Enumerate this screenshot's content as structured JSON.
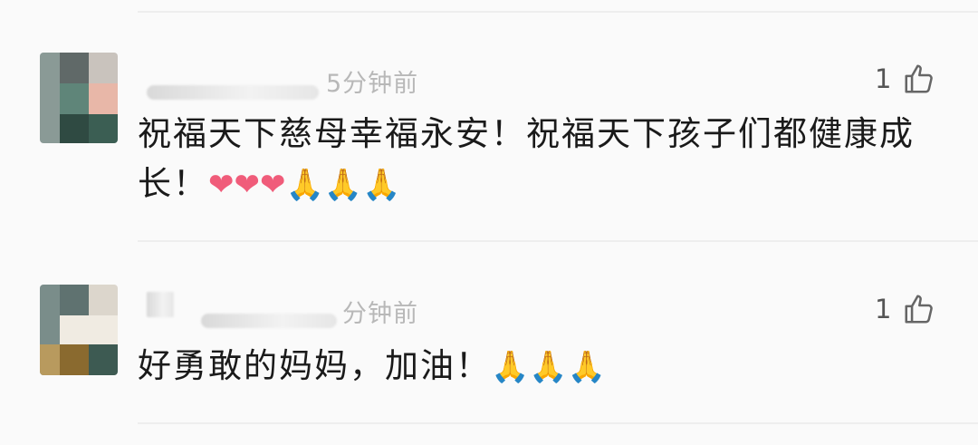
{
  "comments": [
    {
      "time": "5分钟前",
      "likes": "1",
      "text": "祝福天下慈母幸福永安！祝福天下孩子们都健康成长！",
      "emoji": "❤❤❤🙏🙏🙏",
      "avatar_colors": [
        "#8a9a96",
        "#606968",
        "#c9c3bd",
        "#5f8579",
        "#e8b7a8",
        "#2f4a42",
        "#3b5e53"
      ]
    },
    {
      "time": "分钟前",
      "likes": "1",
      "text": "好勇敢的妈妈，加油！",
      "emoji": "🙏🙏🙏",
      "avatar_colors": [
        "#7a8d8a",
        "#5f7270",
        "#dcd6cc",
        "#b89a5e",
        "#8a6a2f",
        "#f0ebe2",
        "#3d5a52"
      ]
    }
  ]
}
